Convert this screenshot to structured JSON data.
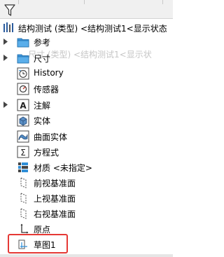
{
  "tree": {
    "root_label": "结构测试 (类型)  <结构测试1<显示状态",
    "ghost_text": "尺寸 (类型)  <结构测试1<显示状",
    "items": [
      {
        "label": "参考",
        "icon": "folder-icon"
      },
      {
        "label": "尺寸",
        "icon": "folder-icon"
      },
      {
        "label": "History",
        "icon": "history-icon"
      },
      {
        "label": "传感器",
        "icon": "sensor-icon"
      },
      {
        "label": "注解",
        "icon": "annotation-icon"
      },
      {
        "label": "实体",
        "icon": "solid-body-icon"
      },
      {
        "label": "曲面实体",
        "icon": "surface-body-icon"
      },
      {
        "label": "方程式",
        "icon": "equation-icon"
      },
      {
        "label": "材质 <未指定>",
        "icon": "material-icon"
      },
      {
        "label": "前视基准面",
        "icon": "plane-icon"
      },
      {
        "label": "上视基准面",
        "icon": "plane-icon"
      },
      {
        "label": "右视基准面",
        "icon": "plane-icon"
      },
      {
        "label": "原点",
        "icon": "origin-icon"
      },
      {
        "label": "草图1",
        "icon": "sketch-icon"
      }
    ]
  },
  "colors": {
    "highlight_border": "#e53935",
    "folder_blue": "#2f8fd8"
  }
}
